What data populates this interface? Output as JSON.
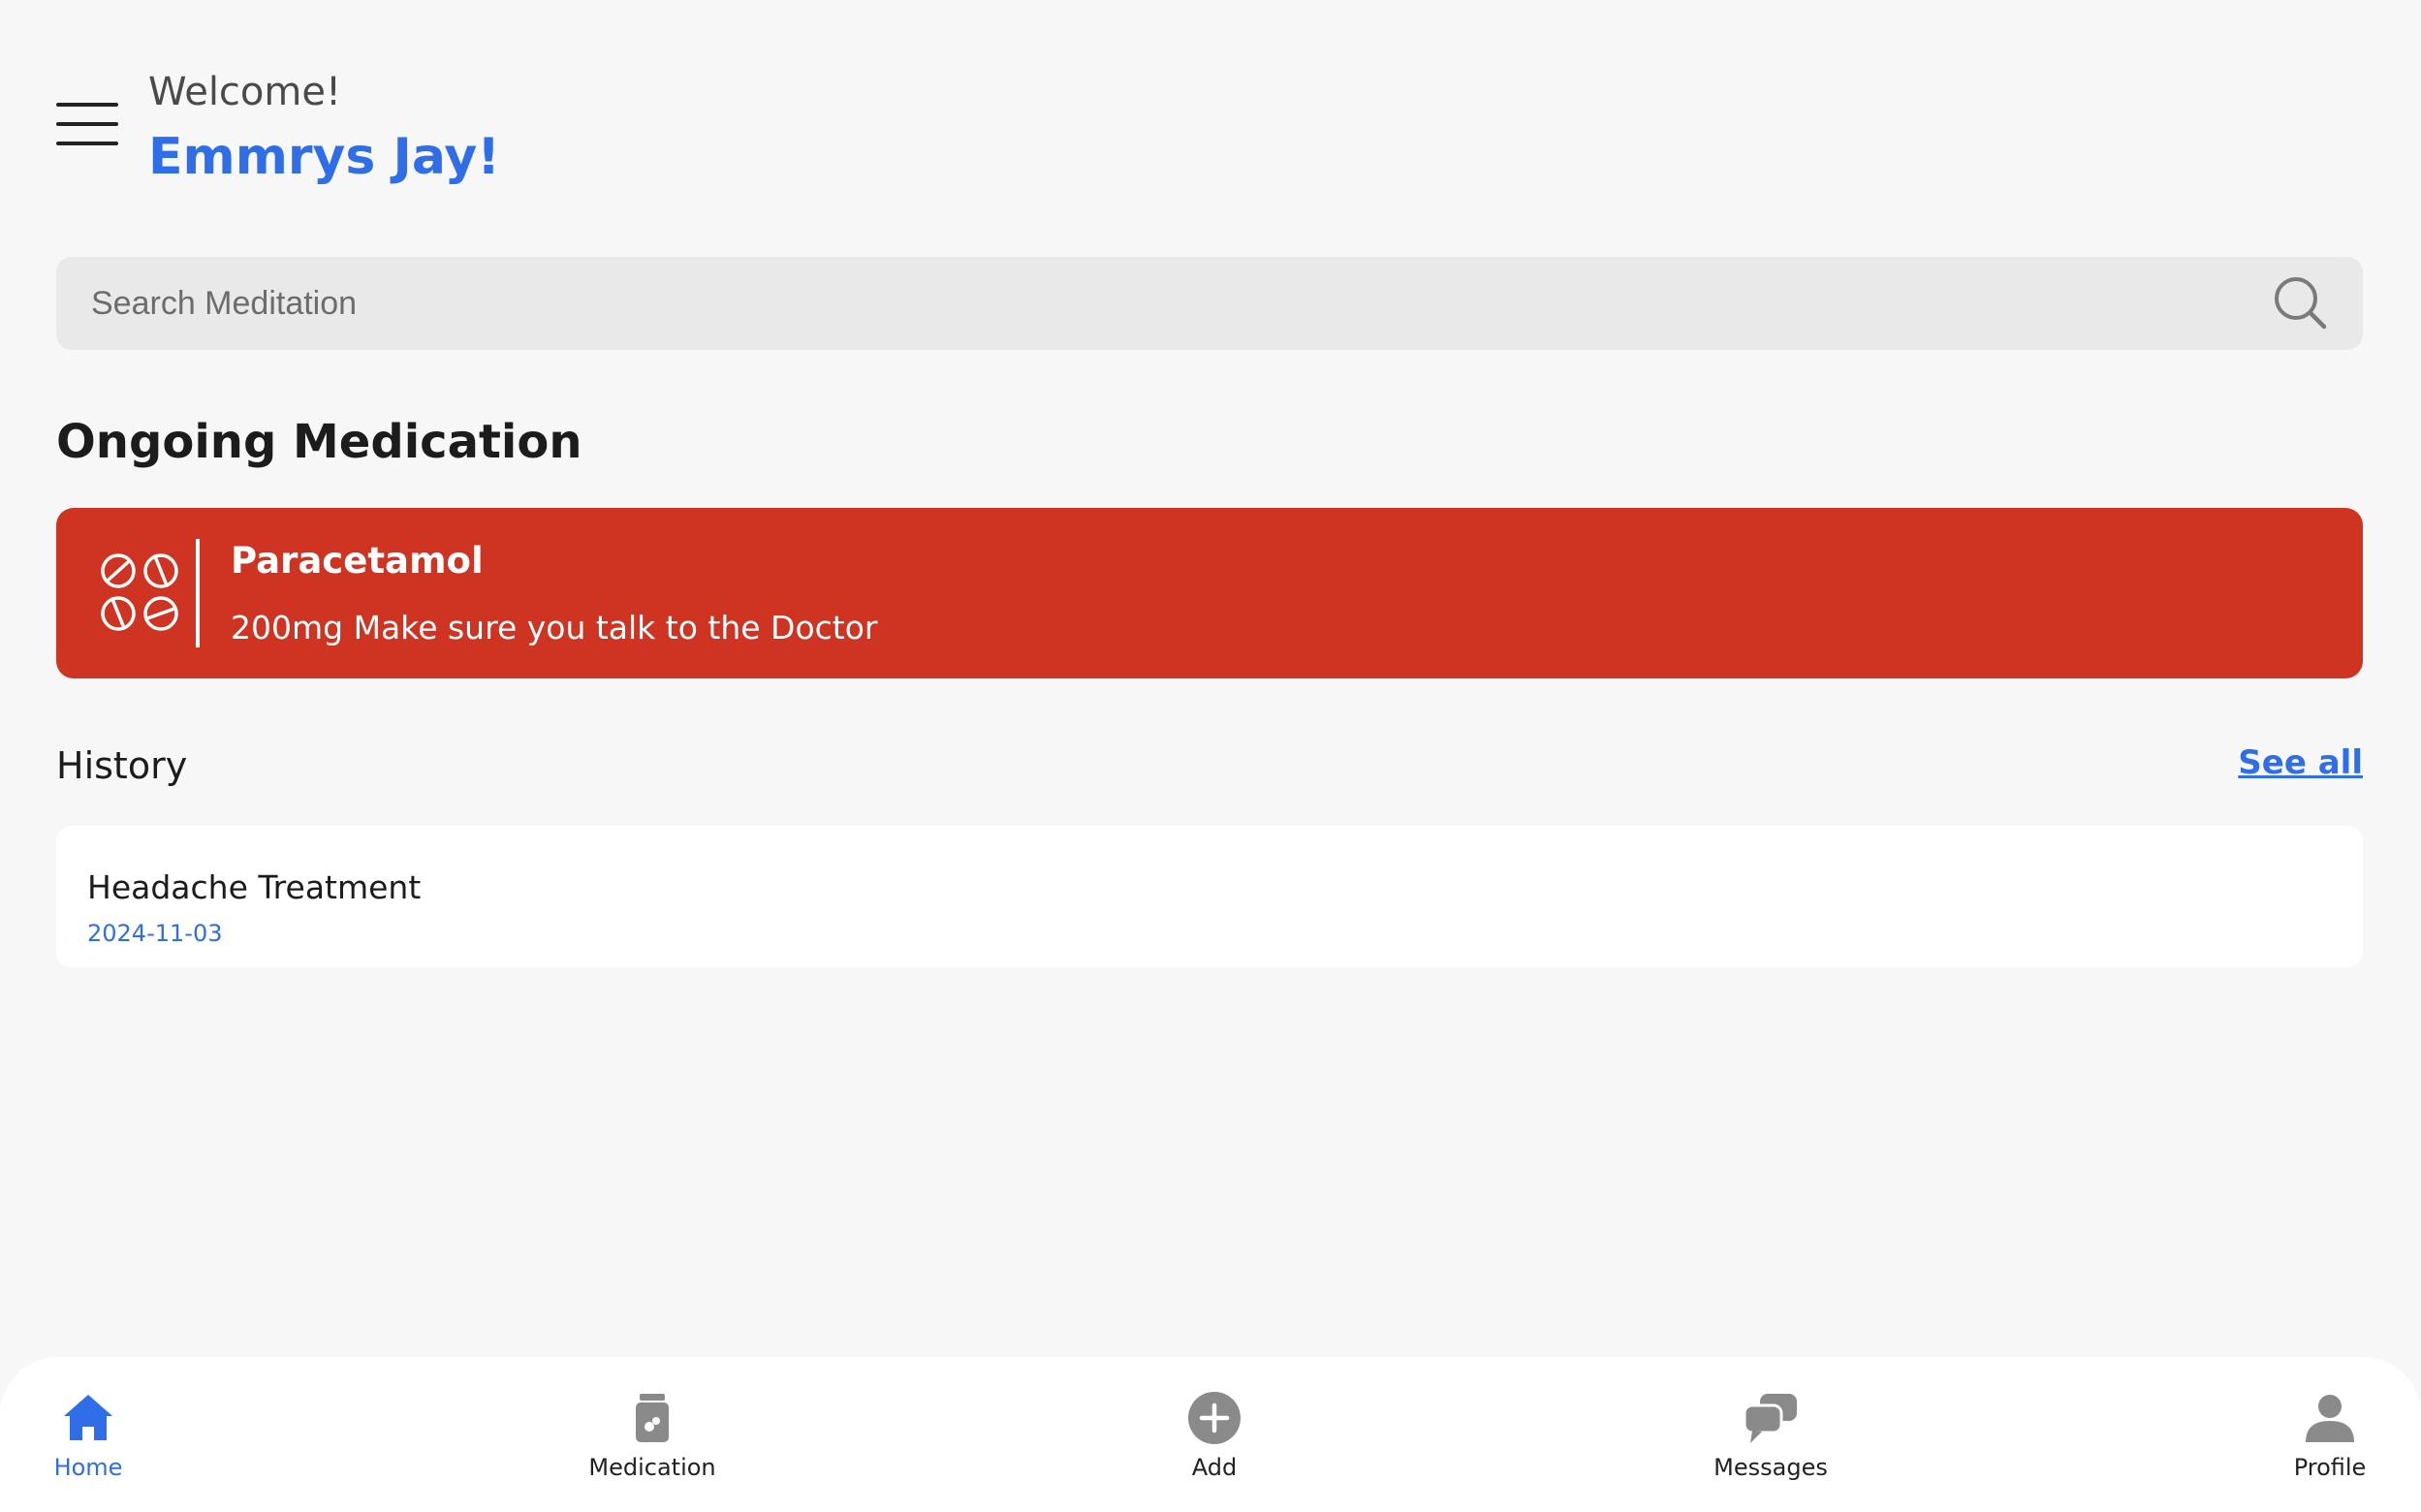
{
  "header": {
    "greeting": "Welcome!",
    "user_name": "Emmrys Jay!"
  },
  "search": {
    "placeholder": "Search Meditation",
    "icon": "search-icon"
  },
  "ongoing": {
    "title": "Ongoing Medication",
    "card": {
      "icon": "pills-icon",
      "name": "Paracetamol",
      "description": "200mg Make sure you talk to the Doctor",
      "color": "#cf3321"
    }
  },
  "history": {
    "title": "History",
    "see_all": "See all",
    "items": [
      {
        "name": "Headache Treatment",
        "date": "2024-11-03"
      }
    ]
  },
  "nav": {
    "items": [
      {
        "label": "Home",
        "icon": "home-icon",
        "active": true
      },
      {
        "label": "Medication",
        "icon": "medication-icon",
        "active": false
      },
      {
        "label": "Add",
        "icon": "add-icon",
        "active": false
      },
      {
        "label": "Messages",
        "icon": "messages-icon",
        "active": false
      },
      {
        "label": "Profile",
        "icon": "profile-icon",
        "active": false
      }
    ]
  },
  "colors": {
    "accent": "#2f6ee6",
    "inactive_icon": "#8a8a8a",
    "background": "#f7f7f7"
  }
}
